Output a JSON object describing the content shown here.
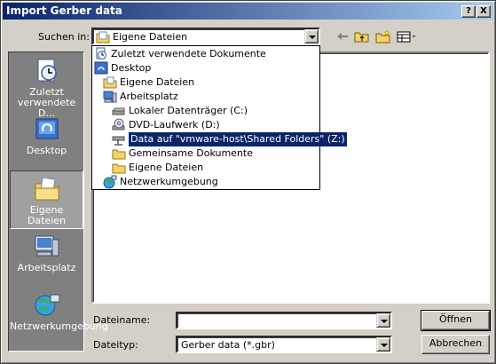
{
  "dialog": {
    "title": "Import Gerber data",
    "help_glyph": "?",
    "close_glyph": "X"
  },
  "look_in": {
    "label": "Suchen in:",
    "value": "Eigene Dateien"
  },
  "dropdown": {
    "items": [
      {
        "label": "Zuletzt verwendete Dokumente",
        "icon": "recent-documents-icon"
      },
      {
        "label": "Desktop",
        "icon": "desktop-icon"
      },
      {
        "label": "Eigene Dateien",
        "icon": "my-documents-icon"
      },
      {
        "label": "Arbeitsplatz",
        "icon": "my-computer-icon"
      },
      {
        "label": "Lokaler Datenträger (C:)",
        "icon": "hard-drive-icon"
      },
      {
        "label": "DVD-Laufwerk (D:)",
        "icon": "dvd-drive-icon"
      },
      {
        "label": "Data auf \"vmware-host\\Shared Folders\" (Z:)",
        "icon": "network-drive-icon"
      },
      {
        "label": "Gemeinsame Dokumente",
        "icon": "folder-icon"
      },
      {
        "label": "Eigene Dateien",
        "icon": "folder-icon"
      },
      {
        "label": "Netzwerkumgebung",
        "icon": "network-icon"
      }
    ]
  },
  "places": [
    {
      "label": "Zuletzt verwendete D...",
      "icon": "recent-documents-icon"
    },
    {
      "label": "Desktop",
      "icon": "desktop-icon"
    },
    {
      "label": "Eigene Dateien",
      "icon": "my-documents-icon"
    },
    {
      "label": "Arbeitsplatz",
      "icon": "my-computer-icon"
    },
    {
      "label": "Netzwerkumgebung",
      "icon": "network-icon"
    }
  ],
  "filename": {
    "label": "Dateiname:",
    "value": ""
  },
  "filetype": {
    "label": "Dateityp:",
    "value": "Gerber data (*.gbr)"
  },
  "buttons": {
    "open": "Öffnen",
    "cancel": "Abbrechen"
  }
}
